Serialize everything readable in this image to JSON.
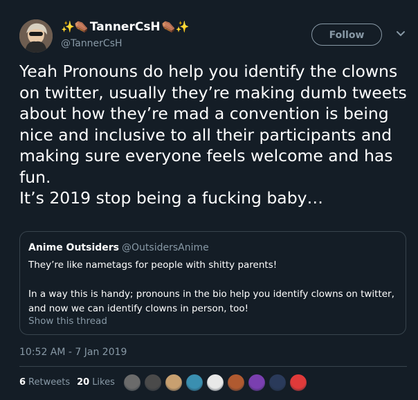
{
  "tweet": {
    "display_name": "TannerCsH",
    "name_emojis_left": "✨⚰️",
    "name_emojis_right": "⚰️✨",
    "handle": "@TannerCsH",
    "follow_label": "Follow",
    "text": "Yeah Pronouns do help you identify the clowns on twitter, usually they’re making dumb tweets about how they’re mad a convention is being nice and inclusive to all their participants and making sure everyone feels welcome and has fun.\nIt’s 2019 stop being a fucking baby…",
    "timestamp": "10:52 AM - 7 Jan 2019"
  },
  "quote": {
    "name": "Anime Outsiders",
    "handle": "@OutsidersAnime",
    "text": "They’re like nametags for people with shitty parents!\n\nIn a way this is handy; pronouns in the bio help you identify clowns on twitter, and now we can identify clowns in person, too!",
    "show_thread": "Show this thread"
  },
  "stats": {
    "retweets_count": "6",
    "retweets_label": "Retweets",
    "likes_count": "20",
    "likes_label": "Likes"
  },
  "likers": [
    {
      "color": "#6b6b6b"
    },
    {
      "color": "#4a4a4a"
    },
    {
      "color": "#c8a070"
    },
    {
      "color": "#3a8fb0"
    },
    {
      "color": "#e8e8e8"
    },
    {
      "color": "#b05a30"
    },
    {
      "color": "#7a3fb0"
    },
    {
      "color": "#2a3a5a"
    },
    {
      "color": "#e03a3a"
    }
  ],
  "colors": {
    "background": "#141d26",
    "secondary_text": "#8899a6",
    "border": "#38444d"
  }
}
